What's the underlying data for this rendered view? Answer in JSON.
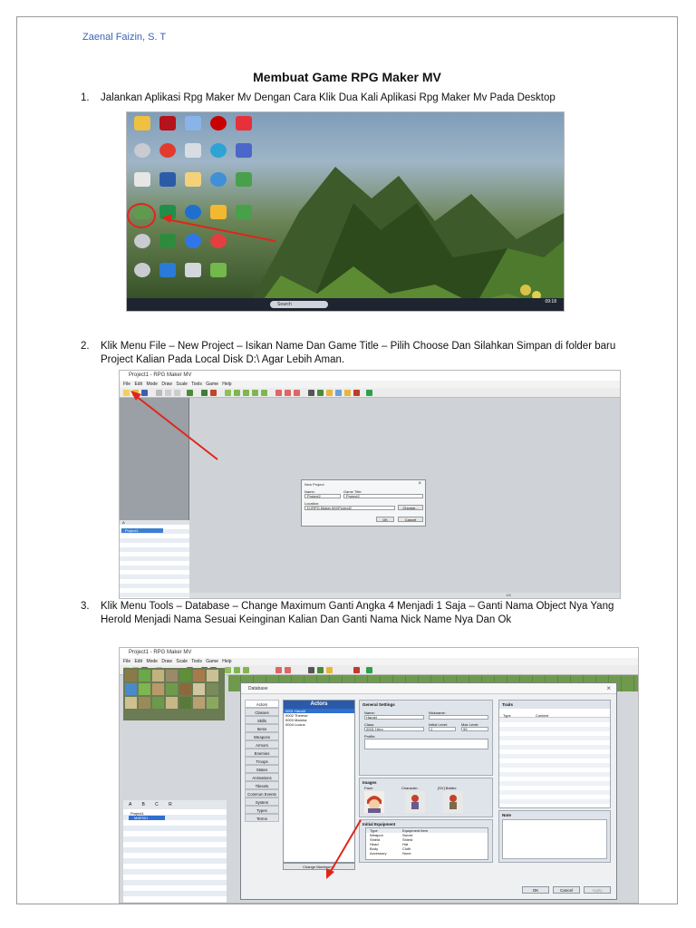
{
  "author": "Zaenal Faizin, S. T",
  "title": "Membuat Game RPG Maker MV",
  "steps": [
    {
      "num": "1.",
      "text": "Jalankan Aplikasi Rpg Maker Mv Dengan Cara Klik Dua Kali Aplikasi Rpg Maker Mv Pada Desktop"
    },
    {
      "num": "2.",
      "text": "Klik Menu File – New Project – Isikan Name Dan Game Title – Pilih Choose Dan Silahkan Simpan di folder baru Project Kalian Pada Local Disk D:\\ Agar Lebih Aman."
    },
    {
      "num": "3.",
      "text": "Klik Menu Tools – Database – Change Maximum Ganti Angka 4 Menjadi 1 Saja – Ganti Nama Object Nya Yang Herold Menjadi Nama Sesuai Keinginan Kalian Dan Ganti Nama Nick Name Nya Dan Ok"
    }
  ],
  "shot1": {
    "search": "Search",
    "clock": "09:18"
  },
  "shot2": {
    "window_title": "Project1 - RPG Maker MV",
    "menu": "File Edit Mode Draw Scale Tools Game Help",
    "tree_tabs": "A",
    "tree_item": "Project1",
    "status": "1/1",
    "dialog": {
      "title": "New Project",
      "name_label": "Name:",
      "name_value": "Project2",
      "game_title_label": "Game Title:",
      "game_title_value": "Project2",
      "location_label": "Location:",
      "location_value": "D:\\RPG Maker MV\\Project2",
      "choose": "Choose...",
      "ok": "OK",
      "cancel": "Cancel"
    }
  },
  "shot3": {
    "window_title": "Project1 - RPG Maker MV",
    "menu": "File Edit Mode Draw Scale Tools Game Help",
    "tree_tabs": "A B C R",
    "tree_items": [
      "Project1",
      "MAP001"
    ],
    "db_title": "Database",
    "categories": [
      "Actors",
      "Classes",
      "Skills",
      "Items",
      "Weapons",
      "Armors",
      "Enemies",
      "Troops",
      "States",
      "Animations",
      "Tilesets",
      "Common Events",
      "System",
      "Types",
      "Terms"
    ],
    "actors_header": "Actors",
    "actors": [
      "0001 Harold",
      "0002 Therese",
      "0003 Marsha",
      "0004 Lucius"
    ],
    "change_max": "Change Maximum...",
    "general": {
      "title": "General Settings",
      "name_label": "Name:",
      "name_value": "Harold",
      "nick_label": "Nickname:",
      "class_label": "Class:",
      "class_value": "0001 Hero",
      "init_label": "Initial Level:",
      "init_value": "1",
      "max_label": "Max Level:",
      "max_value": "99",
      "profile_label": "Profile:"
    },
    "images": {
      "title": "Images",
      "face": "Face:",
      "character": "Character:",
      "battler": "[SV] Battler:"
    },
    "equipment": {
      "title": "Initial Equipment",
      "col_type": "Type",
      "col_item": "Equipment Item",
      "rows": [
        [
          "Weapon",
          "Sword"
        ],
        [
          "Shield",
          "Shield"
        ],
        [
          "Head",
          "Hat"
        ],
        [
          "Body",
          "Cloth"
        ],
        [
          "Accessory",
          "None"
        ]
      ]
    },
    "traits": {
      "title": "Traits",
      "col_type": "Type",
      "col_content": "Content"
    },
    "note": "Note",
    "ok": "OK",
    "cancel": "Cancel",
    "apply": "Apply"
  },
  "colors": {
    "author": "#3a63b8",
    "annotation_red": "#e1251b",
    "selection_blue": "#2f6fd0"
  }
}
